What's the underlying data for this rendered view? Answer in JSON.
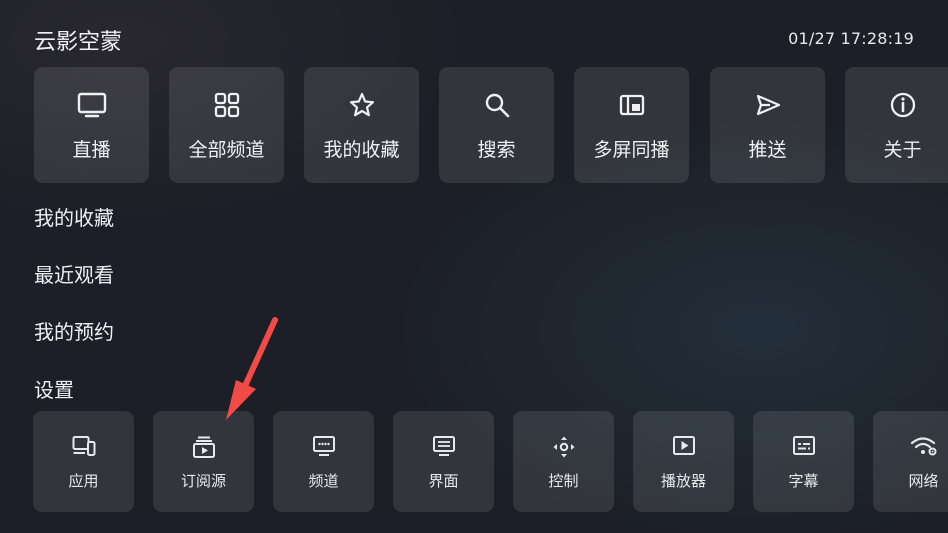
{
  "header": {
    "app_title": "云影空蒙",
    "clock": "01/27 17:28:19"
  },
  "main_menu": [
    {
      "label": "直播",
      "icon": "tv-icon"
    },
    {
      "label": "全部频道",
      "icon": "grid-icon"
    },
    {
      "label": "我的收藏",
      "icon": "star-icon"
    },
    {
      "label": "搜索",
      "icon": "search-icon"
    },
    {
      "label": "多屏同播",
      "icon": "multiscreen-icon"
    },
    {
      "label": "推送",
      "icon": "send-icon"
    },
    {
      "label": "关于",
      "icon": "info-icon"
    }
  ],
  "sections": {
    "favorites": "我的收藏",
    "recent": "最近观看",
    "reservations": "我的预约",
    "settings": "设置"
  },
  "settings_menu": [
    {
      "label": "应用",
      "icon": "devices-icon"
    },
    {
      "label": "订阅源",
      "icon": "subscriptions-icon"
    },
    {
      "label": "频道",
      "icon": "channel-icon"
    },
    {
      "label": "界面",
      "icon": "interface-icon"
    },
    {
      "label": "控制",
      "icon": "remote-control-icon"
    },
    {
      "label": "播放器",
      "icon": "player-icon"
    },
    {
      "label": "字幕",
      "icon": "subtitles-icon"
    },
    {
      "label": "网络",
      "icon": "wifi-settings-icon"
    }
  ],
  "colors": {
    "background": "#1c1f27",
    "tile": "#33363e",
    "text": "#ecedf1",
    "annotation_arrow": "#f24a46"
  }
}
